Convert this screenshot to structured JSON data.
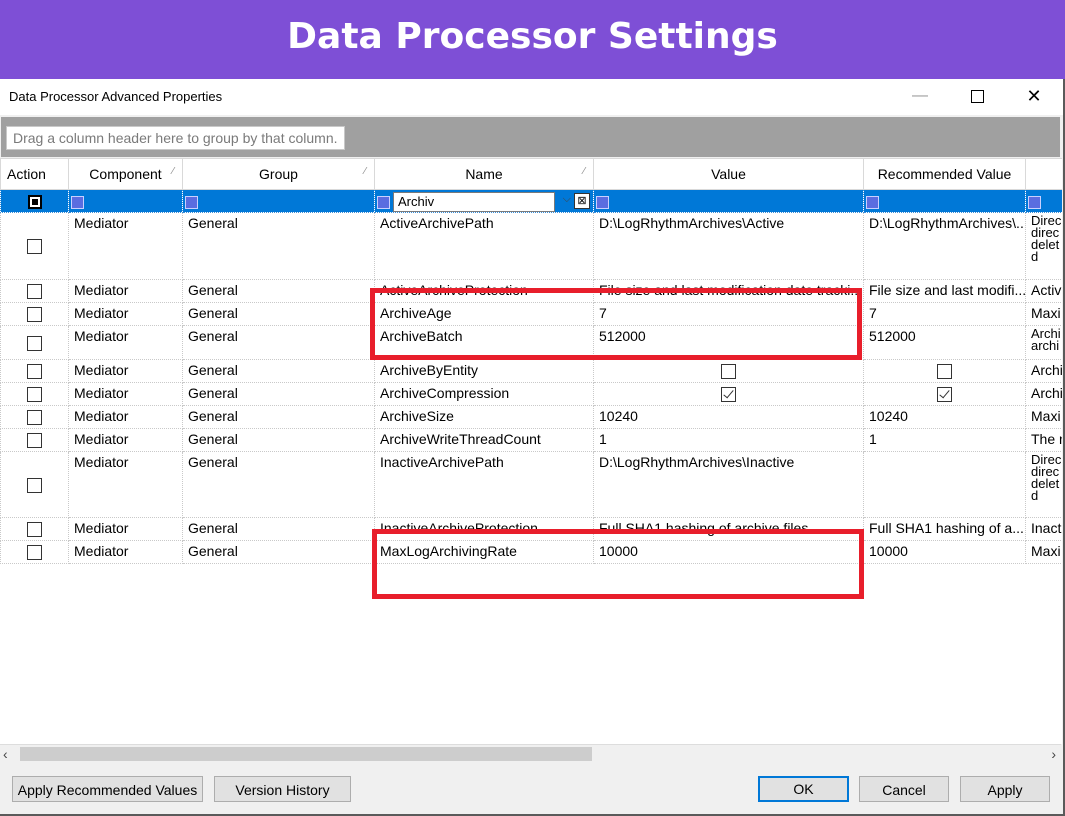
{
  "banner": {
    "title": "Data Processor Settings"
  },
  "dialog": {
    "title": "Data Processor Advanced Properties"
  },
  "window_controls": {
    "minimize": "—",
    "maximize": "",
    "close": "✕"
  },
  "group_panel": {
    "hint": "Drag a column header here to group by that column."
  },
  "columns": {
    "action": "Action",
    "component": "Component",
    "group": "Group",
    "name": "Name",
    "value": "Value",
    "recommended": "Recommended Value"
  },
  "filter": {
    "name_value": "Archiv"
  },
  "rows": [
    {
      "component": "Mediator",
      "group": "General",
      "name": "ActiveArchivePath",
      "value": "D:\\LogRhythmArchives\\Active",
      "recommended": "D:\\LogRhythmArchives\\...",
      "description": "Direc direc delet this d"
    },
    {
      "component": "Mediator",
      "group": "General",
      "name": "ActiveArchiveProtection",
      "value": "File size and last modification date tracki...",
      "recommended": "File size and last modifi...",
      "description": "Activ"
    },
    {
      "component": "Mediator",
      "group": "General",
      "name": "ArchiveAge",
      "value": "7",
      "recommended": "7",
      "description": "Maxi"
    },
    {
      "component": "Mediator",
      "group": "General",
      "name": "ArchiveBatch",
      "value": "512000",
      "recommended": "512000",
      "description": "Archi archi"
    },
    {
      "component": "Mediator",
      "group": "General",
      "name": "ArchiveByEntity",
      "value": "",
      "recommended": "",
      "description": "Archi"
    },
    {
      "component": "Mediator",
      "group": "General",
      "name": "ArchiveCompression",
      "value": "",
      "recommended": "",
      "description": "Archi"
    },
    {
      "component": "Mediator",
      "group": "General",
      "name": "ArchiveSize",
      "value": "10240",
      "recommended": "10240",
      "description": "Maxi"
    },
    {
      "component": "Mediator",
      "group": "General",
      "name": "ArchiveWriteThreadCount",
      "value": "1",
      "recommended": "1",
      "description": "The n"
    },
    {
      "component": "Mediator",
      "group": "General",
      "name": "InactiveArchivePath",
      "value": "D:\\LogRhythmArchives\\Inactive",
      "recommended": "",
      "description": "Direc direc delet this d"
    },
    {
      "component": "Mediator",
      "group": "General",
      "name": "InactiveArchiveProtection",
      "value": "Full SHA1 hashing of archive files",
      "recommended": "Full SHA1 hashing of a...",
      "description": "Inacti"
    },
    {
      "component": "Mediator",
      "group": "General",
      "name": "MaxLogArchivingRate",
      "value": "10000",
      "recommended": "10000",
      "description": "Maxi"
    }
  ],
  "checkbox_states": {
    "archive_by_entity": {
      "value": false,
      "recommended": false
    },
    "archive_compression": {
      "value": true,
      "recommended": true
    }
  },
  "scrollbar": {
    "left_arrow": "‹",
    "right_arrow": "›"
  },
  "buttons": {
    "apply_recommended": "Apply Recommended Values",
    "version_history": "Version History",
    "ok": "OK",
    "cancel": "Cancel",
    "apply": "Apply"
  },
  "colors": {
    "banner": "#7e4fd6",
    "filter_row": "#0078d7",
    "highlight": "#e81e2b"
  }
}
